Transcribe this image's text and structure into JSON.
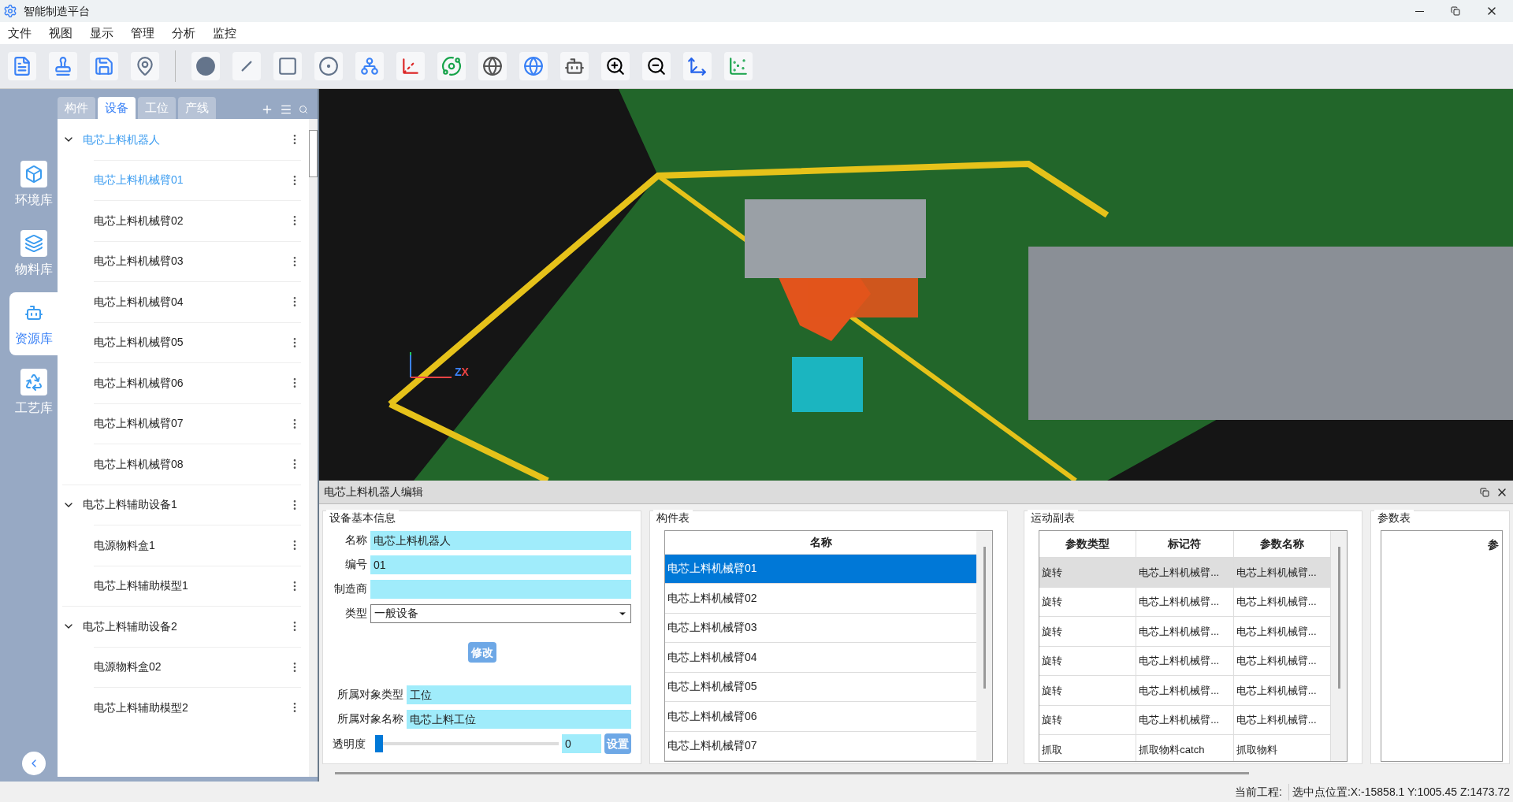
{
  "window": {
    "title": "智能制造平台"
  },
  "menu": [
    "文件",
    "视图",
    "显示",
    "管理",
    "分析",
    "监控"
  ],
  "side_nav": [
    {
      "label": "环境库",
      "kind": "env",
      "selected": false
    },
    {
      "label": "物料库",
      "kind": "material",
      "selected": false
    },
    {
      "label": "资源库",
      "kind": "resource",
      "selected": true
    },
    {
      "label": "工艺库",
      "kind": "process",
      "selected": false
    }
  ],
  "tree_tabs": [
    {
      "label": "构件",
      "selected": false
    },
    {
      "label": "设备",
      "selected": true
    },
    {
      "label": "工位",
      "selected": false
    },
    {
      "label": "产线",
      "selected": false
    }
  ],
  "tree": [
    {
      "label": "电芯上料机器人",
      "selected": true,
      "expanded": true,
      "children": [
        {
          "label": "电芯上料机械臂01",
          "selected": true
        },
        {
          "label": "电芯上料机械臂02",
          "selected": false
        },
        {
          "label": "电芯上料机械臂03",
          "selected": false
        },
        {
          "label": "电芯上料机械臂04",
          "selected": false
        },
        {
          "label": "电芯上料机械臂05",
          "selected": false
        },
        {
          "label": "电芯上料机械臂06",
          "selected": false
        },
        {
          "label": "电芯上料机械臂07",
          "selected": false
        },
        {
          "label": "电芯上料机械臂08",
          "selected": false
        }
      ]
    },
    {
      "label": "电芯上料辅助设备1",
      "selected": false,
      "expanded": true,
      "children": [
        {
          "label": "电源物料盒1",
          "selected": false
        },
        {
          "label": "电芯上料辅助模型1",
          "selected": false
        }
      ]
    },
    {
      "label": "电芯上料辅助设备2",
      "selected": false,
      "expanded": true,
      "children": [
        {
          "label": "电源物料盒02",
          "selected": false
        },
        {
          "label": "电芯上料辅助模型2",
          "selected": false
        }
      ]
    }
  ],
  "viewport": {
    "axis_labels": [
      "Z",
      "X"
    ]
  },
  "editor": {
    "title": "电芯上料机器人编辑",
    "basic_info": {
      "title": "设备基本信息",
      "fields": [
        {
          "label": "名称",
          "value": "电芯上料机器人"
        },
        {
          "label": "编号",
          "value": "01"
        },
        {
          "label": "制造商"
        }
      ],
      "type_select": {
        "label": "类型",
        "value": "一般设备"
      },
      "modify_button": "修改",
      "owner_fields": [
        {
          "label": "所属对象类型",
          "value": "工位"
        },
        {
          "label": "所属对象名称",
          "value": "电芯上料工位"
        }
      ],
      "opacity": {
        "label": "透明度",
        "level": 0,
        "value": "0",
        "button": "设置"
      }
    },
    "component_table": {
      "title": "构件表",
      "columns": [
        "名称"
      ],
      "rows": [
        {
          "cells": [
            "电芯上料机械臂01"
          ],
          "selected": true
        },
        {
          "cells": [
            "电芯上料机械臂02"
          ],
          "selected": false
        },
        {
          "cells": [
            "电芯上料机械臂03"
          ],
          "selected": false
        },
        {
          "cells": [
            "电芯上料机械臂04"
          ],
          "selected": false
        },
        {
          "cells": [
            "电芯上料机械臂05"
          ],
          "selected": false
        },
        {
          "cells": [
            "电芯上料机械臂06"
          ],
          "selected": false
        },
        {
          "cells": [
            "电芯上料机械臂07"
          ],
          "selected": false
        }
      ]
    },
    "motion_table": {
      "title": "运动副表",
      "columns": [
        "参数类型",
        "标记符",
        "参数名称"
      ],
      "rows": [
        {
          "cells": [
            "旋转",
            "电芯上料机械臂...",
            "电芯上料机械臂..."
          ],
          "selected": true
        },
        {
          "cells": [
            "旋转",
            "电芯上料机械臂...",
            "电芯上料机械臂..."
          ],
          "selected": false
        },
        {
          "cells": [
            "旋转",
            "电芯上料机械臂...",
            "电芯上料机械臂..."
          ],
          "selected": false
        },
        {
          "cells": [
            "旋转",
            "电芯上料机械臂...",
            "电芯上料机械臂..."
          ],
          "selected": false
        },
        {
          "cells": [
            "旋转",
            "电芯上料机械臂...",
            "电芯上料机械臂..."
          ],
          "selected": false
        },
        {
          "cells": [
            "旋转",
            "电芯上料机械臂...",
            "电芯上料机械臂..."
          ],
          "selected": false
        },
        {
          "cells": [
            "抓取",
            "抓取物料catch",
            "抓取物料"
          ],
          "selected": false
        }
      ]
    },
    "param_table": {
      "title": "参数表",
      "columns": [
        "参"
      ]
    }
  },
  "status_bar": {
    "project": "当前工程:",
    "position": "选中点位置:X:-15858.1 Y:1005.45 Z:1473.72"
  }
}
